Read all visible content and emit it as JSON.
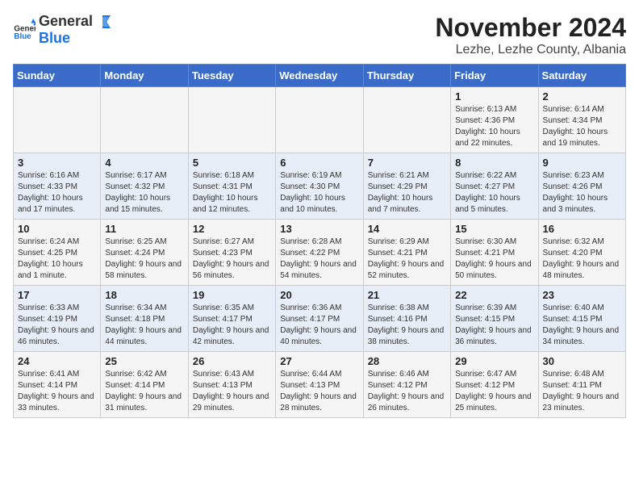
{
  "logo": {
    "general": "General",
    "blue": "Blue"
  },
  "title": "November 2024",
  "subtitle": "Lezhe, Lezhe County, Albania",
  "days_of_week": [
    "Sunday",
    "Monday",
    "Tuesday",
    "Wednesday",
    "Thursday",
    "Friday",
    "Saturday"
  ],
  "weeks": [
    [
      {
        "day": "",
        "info": ""
      },
      {
        "day": "",
        "info": ""
      },
      {
        "day": "",
        "info": ""
      },
      {
        "day": "",
        "info": ""
      },
      {
        "day": "",
        "info": ""
      },
      {
        "day": "1",
        "info": "Sunrise: 6:13 AM\nSunset: 4:36 PM\nDaylight: 10 hours and 22 minutes."
      },
      {
        "day": "2",
        "info": "Sunrise: 6:14 AM\nSunset: 4:34 PM\nDaylight: 10 hours and 19 minutes."
      }
    ],
    [
      {
        "day": "3",
        "info": "Sunrise: 6:16 AM\nSunset: 4:33 PM\nDaylight: 10 hours and 17 minutes."
      },
      {
        "day": "4",
        "info": "Sunrise: 6:17 AM\nSunset: 4:32 PM\nDaylight: 10 hours and 15 minutes."
      },
      {
        "day": "5",
        "info": "Sunrise: 6:18 AM\nSunset: 4:31 PM\nDaylight: 10 hours and 12 minutes."
      },
      {
        "day": "6",
        "info": "Sunrise: 6:19 AM\nSunset: 4:30 PM\nDaylight: 10 hours and 10 minutes."
      },
      {
        "day": "7",
        "info": "Sunrise: 6:21 AM\nSunset: 4:29 PM\nDaylight: 10 hours and 7 minutes."
      },
      {
        "day": "8",
        "info": "Sunrise: 6:22 AM\nSunset: 4:27 PM\nDaylight: 10 hours and 5 minutes."
      },
      {
        "day": "9",
        "info": "Sunrise: 6:23 AM\nSunset: 4:26 PM\nDaylight: 10 hours and 3 minutes."
      }
    ],
    [
      {
        "day": "10",
        "info": "Sunrise: 6:24 AM\nSunset: 4:25 PM\nDaylight: 10 hours and 1 minute."
      },
      {
        "day": "11",
        "info": "Sunrise: 6:25 AM\nSunset: 4:24 PM\nDaylight: 9 hours and 58 minutes."
      },
      {
        "day": "12",
        "info": "Sunrise: 6:27 AM\nSunset: 4:23 PM\nDaylight: 9 hours and 56 minutes."
      },
      {
        "day": "13",
        "info": "Sunrise: 6:28 AM\nSunset: 4:22 PM\nDaylight: 9 hours and 54 minutes."
      },
      {
        "day": "14",
        "info": "Sunrise: 6:29 AM\nSunset: 4:21 PM\nDaylight: 9 hours and 52 minutes."
      },
      {
        "day": "15",
        "info": "Sunrise: 6:30 AM\nSunset: 4:21 PM\nDaylight: 9 hours and 50 minutes."
      },
      {
        "day": "16",
        "info": "Sunrise: 6:32 AM\nSunset: 4:20 PM\nDaylight: 9 hours and 48 minutes."
      }
    ],
    [
      {
        "day": "17",
        "info": "Sunrise: 6:33 AM\nSunset: 4:19 PM\nDaylight: 9 hours and 46 minutes."
      },
      {
        "day": "18",
        "info": "Sunrise: 6:34 AM\nSunset: 4:18 PM\nDaylight: 9 hours and 44 minutes."
      },
      {
        "day": "19",
        "info": "Sunrise: 6:35 AM\nSunset: 4:17 PM\nDaylight: 9 hours and 42 minutes."
      },
      {
        "day": "20",
        "info": "Sunrise: 6:36 AM\nSunset: 4:17 PM\nDaylight: 9 hours and 40 minutes."
      },
      {
        "day": "21",
        "info": "Sunrise: 6:38 AM\nSunset: 4:16 PM\nDaylight: 9 hours and 38 minutes."
      },
      {
        "day": "22",
        "info": "Sunrise: 6:39 AM\nSunset: 4:15 PM\nDaylight: 9 hours and 36 minutes."
      },
      {
        "day": "23",
        "info": "Sunrise: 6:40 AM\nSunset: 4:15 PM\nDaylight: 9 hours and 34 minutes."
      }
    ],
    [
      {
        "day": "24",
        "info": "Sunrise: 6:41 AM\nSunset: 4:14 PM\nDaylight: 9 hours and 33 minutes."
      },
      {
        "day": "25",
        "info": "Sunrise: 6:42 AM\nSunset: 4:14 PM\nDaylight: 9 hours and 31 minutes."
      },
      {
        "day": "26",
        "info": "Sunrise: 6:43 AM\nSunset: 4:13 PM\nDaylight: 9 hours and 29 minutes."
      },
      {
        "day": "27",
        "info": "Sunrise: 6:44 AM\nSunset: 4:13 PM\nDaylight: 9 hours and 28 minutes."
      },
      {
        "day": "28",
        "info": "Sunrise: 6:46 AM\nSunset: 4:12 PM\nDaylight: 9 hours and 26 minutes."
      },
      {
        "day": "29",
        "info": "Sunrise: 6:47 AM\nSunset: 4:12 PM\nDaylight: 9 hours and 25 minutes."
      },
      {
        "day": "30",
        "info": "Sunrise: 6:48 AM\nSunset: 4:11 PM\nDaylight: 9 hours and 23 minutes."
      }
    ]
  ]
}
